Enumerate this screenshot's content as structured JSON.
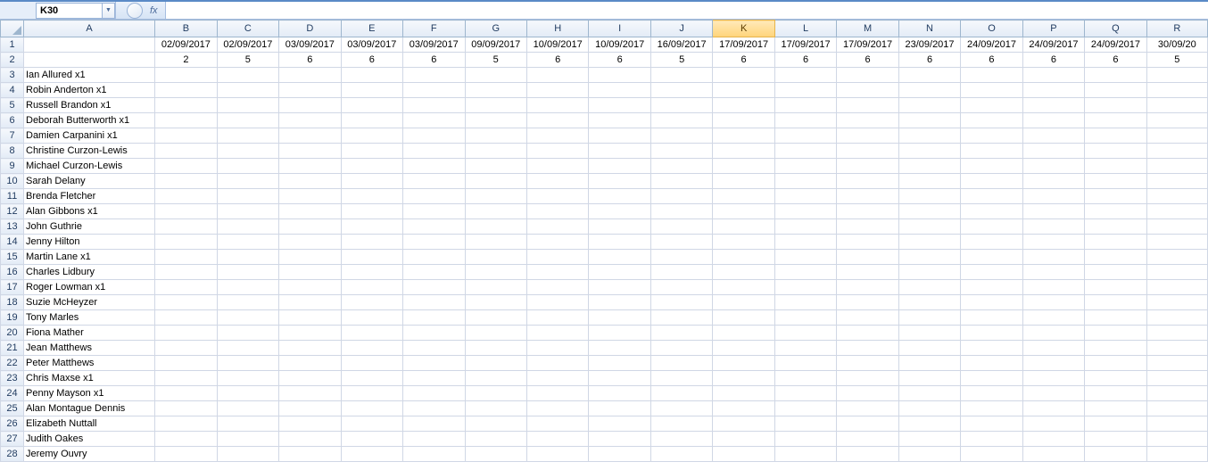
{
  "name_box": "K30",
  "fx_label": "fx",
  "formula_value": "",
  "selected_col_index": 10,
  "columns": [
    "A",
    "B",
    "C",
    "D",
    "E",
    "F",
    "G",
    "H",
    "I",
    "J",
    "K",
    "L",
    "M",
    "N",
    "O",
    "P",
    "Q",
    "R"
  ],
  "row1": [
    "",
    "02/09/2017",
    "02/09/2017",
    "03/09/2017",
    "03/09/2017",
    "03/09/2017",
    "09/09/2017",
    "10/09/2017",
    "10/09/2017",
    "16/09/2017",
    "17/09/2017",
    "17/09/2017",
    "17/09/2017",
    "23/09/2017",
    "24/09/2017",
    "24/09/2017",
    "24/09/2017",
    "30/09/20"
  ],
  "row2": [
    "",
    "2",
    "5",
    "6",
    "6",
    "6",
    "5",
    "6",
    "6",
    "5",
    "6",
    "6",
    "6",
    "6",
    "6",
    "6",
    "6",
    "5"
  ],
  "names": [
    "Ian Allured x1",
    "Robin Anderton x1",
    "Russell Brandon x1",
    "Deborah Butterworth x1",
    "Damien Carpanini x1",
    "Christine Curzon-Lewis",
    "Michael Curzon-Lewis",
    "Sarah Delany",
    "Brenda Fletcher",
    "Alan Gibbons x1",
    "John Guthrie",
    "Jenny Hilton",
    "Martin Lane x1",
    "Charles Lidbury",
    "Roger Lowman x1",
    "Suzie McHeyzer",
    "Tony Marles",
    "Fiona Mather",
    "Jean Matthews",
    "Peter Matthews",
    "Chris Maxse x1",
    "Penny Mayson x1",
    "Alan Montague Dennis",
    "Elizabeth Nuttall",
    "Judith Oakes",
    "Jeremy Ouvry"
  ],
  "row_count_visible": 28
}
